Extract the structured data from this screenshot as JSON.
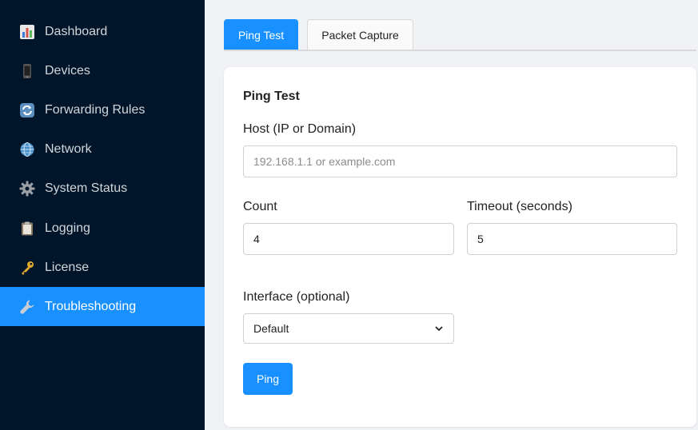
{
  "sidebar": {
    "items": [
      {
        "label": "Dashboard",
        "icon": "bar-chart-icon"
      },
      {
        "label": "Devices",
        "icon": "mobile-phone-icon"
      },
      {
        "label": "Forwarding Rules",
        "icon": "refresh-arrows-icon"
      },
      {
        "label": "Network",
        "icon": "globe-icon"
      },
      {
        "label": "System Status",
        "icon": "gear-icon"
      },
      {
        "label": "Logging",
        "icon": "clipboard-icon"
      },
      {
        "label": "License",
        "icon": "key-icon"
      },
      {
        "label": "Troubleshooting",
        "icon": "wrench-icon",
        "active": true
      }
    ]
  },
  "tabs": [
    {
      "label": "Ping Test",
      "active": true
    },
    {
      "label": "Packet Capture",
      "active": false
    }
  ],
  "form": {
    "title": "Ping Test",
    "host": {
      "label": "Host (IP or Domain)",
      "placeholder": "192.168.1.1 or example.com",
      "value": ""
    },
    "count": {
      "label": "Count",
      "value": "4"
    },
    "timeout": {
      "label": "Timeout (seconds)",
      "value": "5"
    },
    "interface": {
      "label": "Interface (optional)",
      "selected": "Default"
    },
    "submit_label": "Ping"
  },
  "colors": {
    "sidebar_bg": "#001529",
    "accent": "#1890ff",
    "page_bg": "#f0f2f5"
  }
}
